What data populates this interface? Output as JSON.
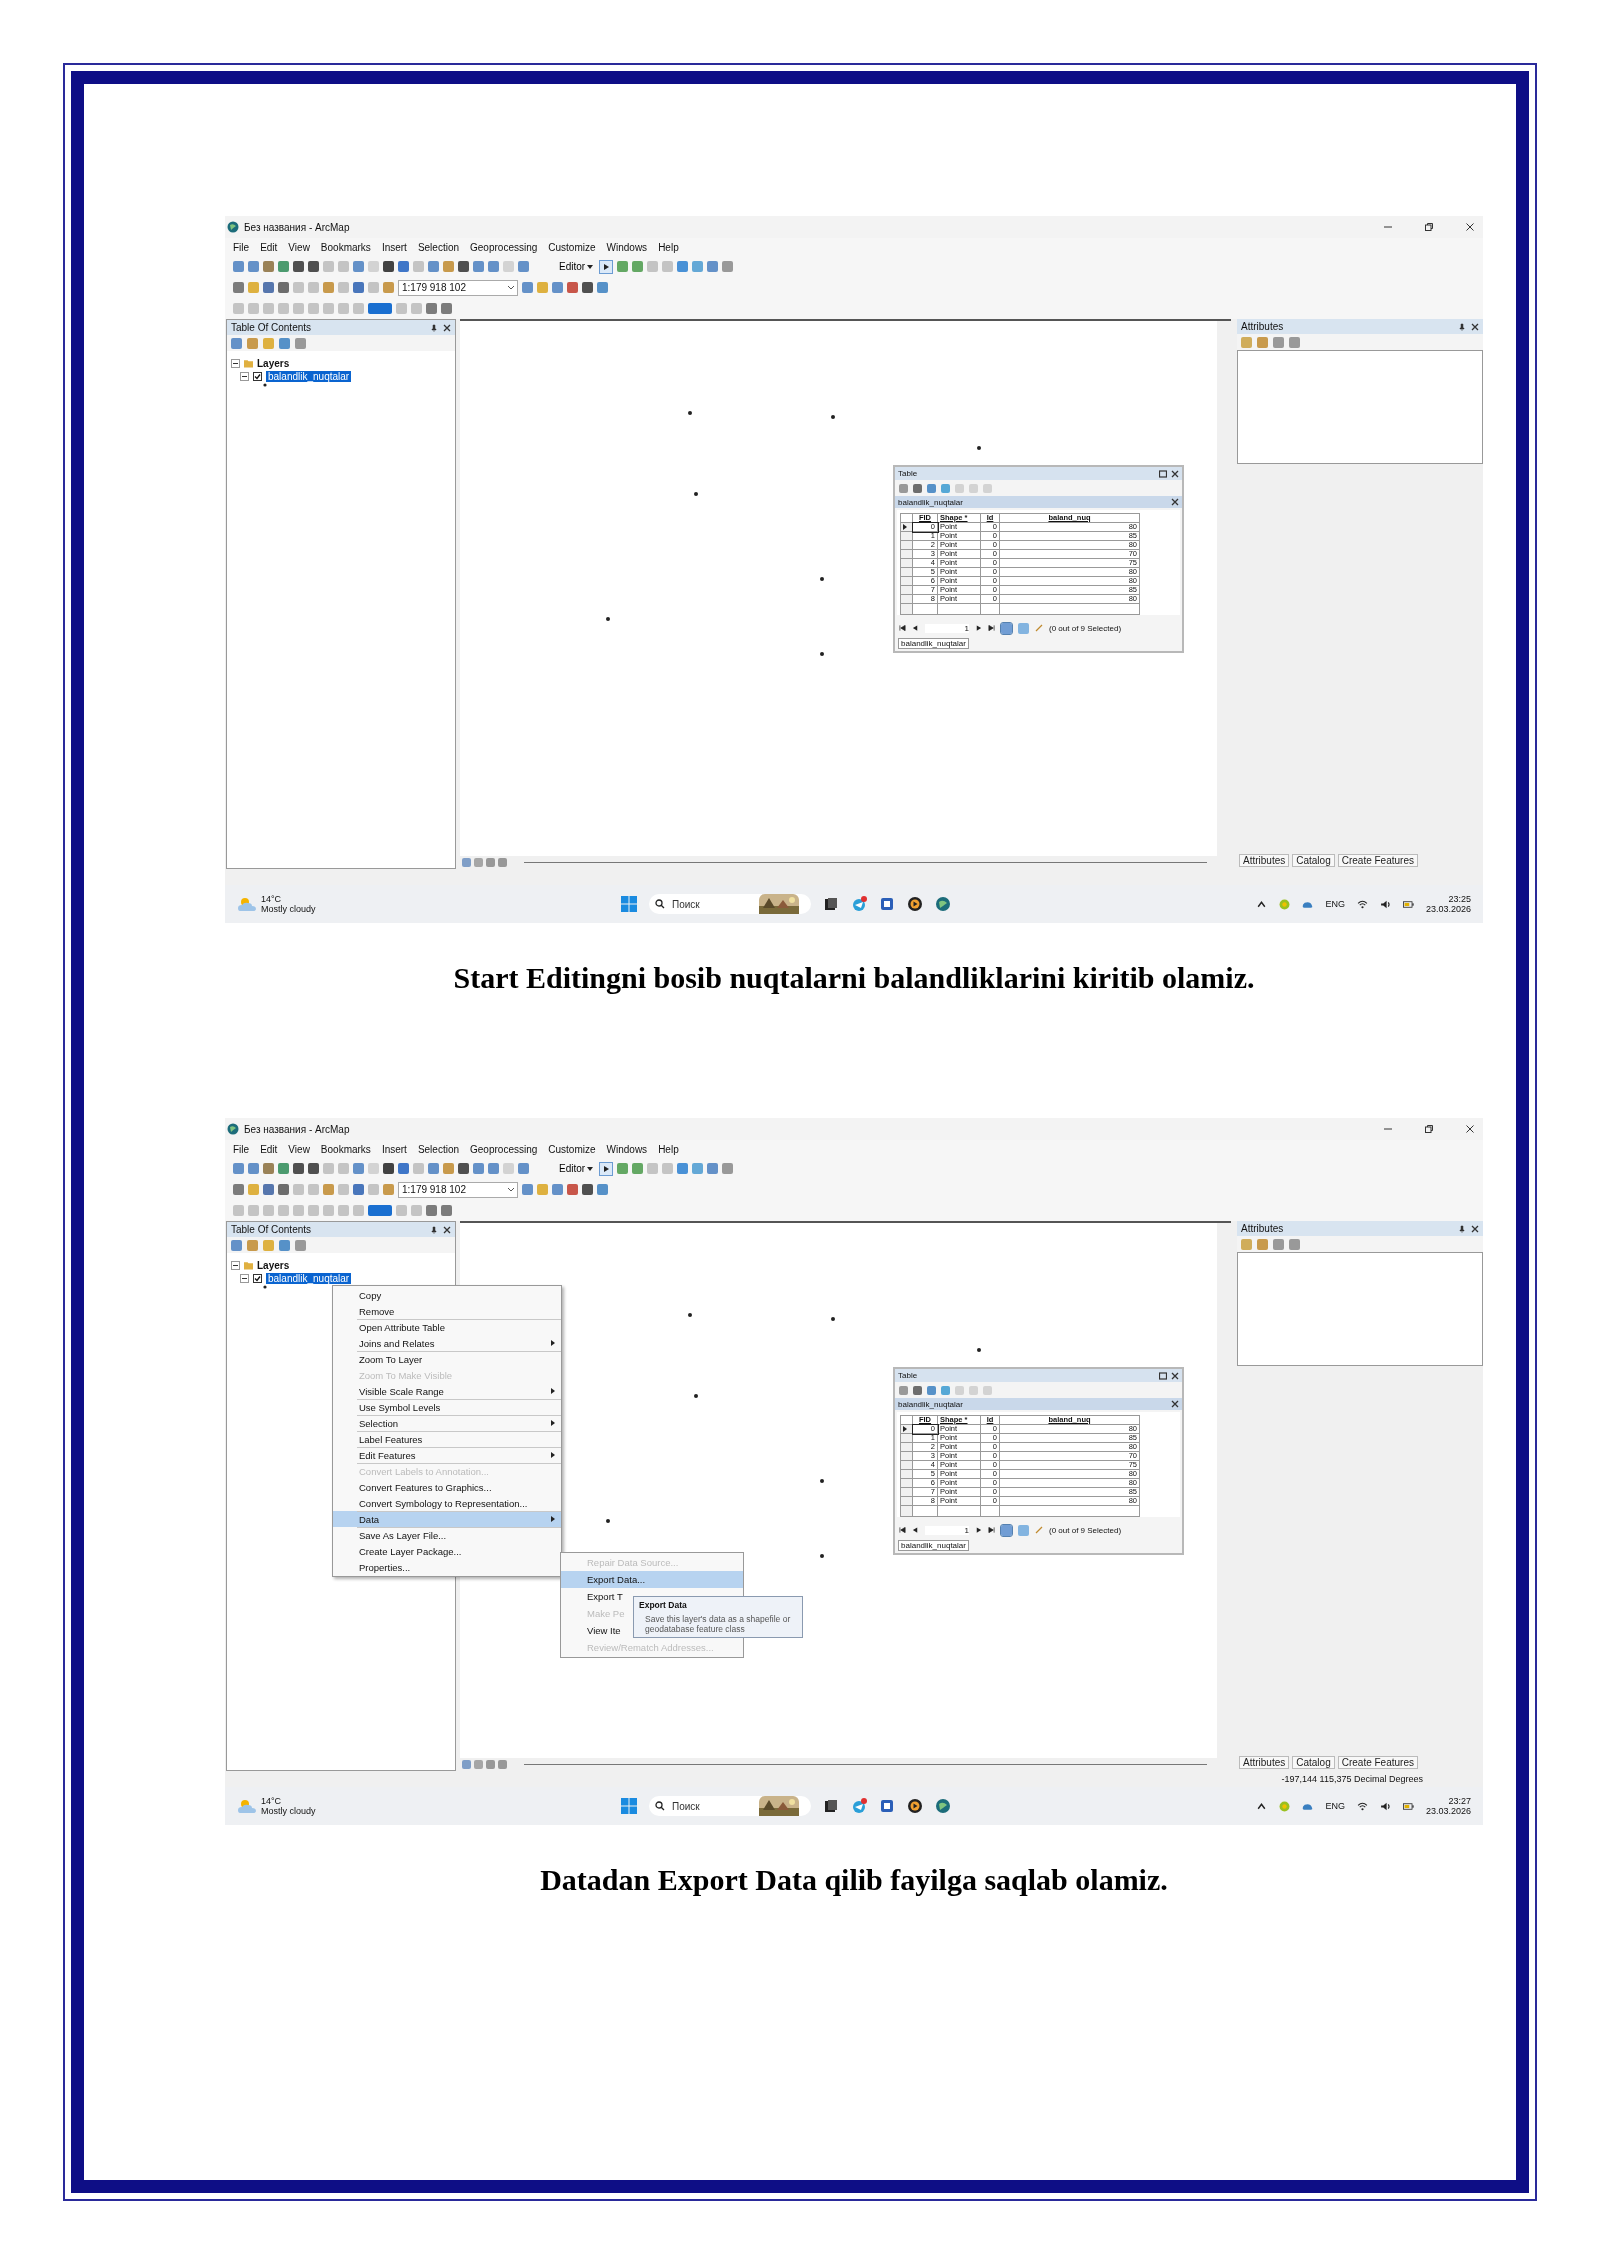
{
  "sections": [
    {
      "screenshot": {
        "window": {
          "title": "Без названия - ArcMap"
        },
        "menu": [
          "File",
          "Edit",
          "View",
          "Bookmarks",
          "Insert",
          "Selection",
          "Geoprocessing",
          "Customize",
          "Windows",
          "Help"
        ],
        "editor_label": "Editor",
        "scale": "1:179 918 102",
        "toc": {
          "title": "Table Of Contents",
          "root": "Layers",
          "layer": {
            "name": "balandlik_nuqtalar",
            "checked": true,
            "selected": true
          }
        },
        "attributes": {
          "title": "Attributes"
        },
        "table": {
          "title": "Table",
          "layer_title": "balandlik_nuqtalar",
          "columns": [
            "FID",
            "Shape *",
            "Id",
            "baland_nuq"
          ],
          "rows": [
            {
              "cells": [
                "0",
                "Point",
                "0",
                "80"
              ],
              "current": true
            },
            {
              "cells": [
                "1",
                "Point",
                "0",
                "85"
              ],
              "current": false
            },
            {
              "cells": [
                "2",
                "Point",
                "0",
                "80"
              ],
              "current": false
            },
            {
              "cells": [
                "3",
                "Point",
                "0",
                "70"
              ],
              "current": false
            },
            {
              "cells": [
                "4",
                "Point",
                "0",
                "75"
              ],
              "current": false
            },
            {
              "cells": [
                "5",
                "Point",
                "0",
                "80"
              ],
              "current": false
            },
            {
              "cells": [
                "6",
                "Point",
                "0",
                "80"
              ],
              "current": false
            },
            {
              "cells": [
                "7",
                "Point",
                "0",
                "85"
              ],
              "current": false
            },
            {
              "cells": [
                "8",
                "Point",
                "0",
                "80"
              ],
              "current": false
            }
          ],
          "page": "1",
          "selection": "(0 out of 9 Selected)",
          "tab": "balandlik_nuqtalar"
        },
        "dock_tabs": [
          "Attributes",
          "Catalog",
          "Create Features"
        ],
        "taskbar": {
          "temperature": "14°C",
          "weather": "Mostly cloudy",
          "search_placeholder": "Поиск",
          "language": "ENG",
          "time": "23:25",
          "date": "23.03.2026"
        }
      },
      "caption": "Start Editingni bosib nuqtalarni balandliklarini kiritib olamiz."
    },
    {
      "screenshot": {
        "window": {
          "title": "Без названия - ArcMap"
        },
        "menu": [
          "File",
          "Edit",
          "View",
          "Bookmarks",
          "Insert",
          "Selection",
          "Geoprocessing",
          "Customize",
          "Windows",
          "Help"
        ],
        "editor_label": "Editor",
        "scale": "1:179 918 102",
        "toc": {
          "title": "Table Of Contents",
          "root": "Layers",
          "layer": {
            "name": "balandlik_nuqtalar",
            "checked": true,
            "selected": true
          }
        },
        "attributes": {
          "title": "Attributes"
        },
        "table": {
          "title": "Table",
          "layer_title": "balandlik_nuqtalar",
          "columns": [
            "FID",
            "Shape *",
            "Id",
            "baland_nuq"
          ],
          "rows": [
            {
              "cells": [
                "0",
                "Point",
                "0",
                "80"
              ],
              "current": true
            },
            {
              "cells": [
                "1",
                "Point",
                "0",
                "85"
              ],
              "current": false
            },
            {
              "cells": [
                "2",
                "Point",
                "0",
                "80"
              ],
              "current": false
            },
            {
              "cells": [
                "3",
                "Point",
                "0",
                "70"
              ],
              "current": false
            },
            {
              "cells": [
                "4",
                "Point",
                "0",
                "75"
              ],
              "current": false
            },
            {
              "cells": [
                "5",
                "Point",
                "0",
                "80"
              ],
              "current": false
            },
            {
              "cells": [
                "6",
                "Point",
                "0",
                "80"
              ],
              "current": false
            },
            {
              "cells": [
                "7",
                "Point",
                "0",
                "85"
              ],
              "current": false
            },
            {
              "cells": [
                "8",
                "Point",
                "0",
                "80"
              ],
              "current": false
            }
          ],
          "page": "1",
          "selection": "(0 out of 9 Selected)",
          "tab": "balandlik_nuqtalar"
        },
        "dock_tabs": [
          "Attributes",
          "Catalog",
          "Create Features"
        ],
        "status": "-197,144  115,375 Decimal Degrees",
        "context_menu": [
          {
            "label": "Copy",
            "disabled": false,
            "selected": false,
            "submenu": false,
            "separator_before": false
          },
          {
            "label": "Remove",
            "disabled": false,
            "selected": false,
            "submenu": false,
            "separator_before": false
          },
          {
            "label": "Open Attribute Table",
            "disabled": false,
            "selected": false,
            "submenu": false,
            "separator_before": true
          },
          {
            "label": "Joins and Relates",
            "disabled": false,
            "selected": false,
            "submenu": true,
            "separator_before": false
          },
          {
            "label": "Zoom To Layer",
            "disabled": false,
            "selected": false,
            "submenu": false,
            "separator_before": true
          },
          {
            "label": "Zoom To Make Visible",
            "disabled": true,
            "selected": false,
            "submenu": false,
            "separator_before": false
          },
          {
            "label": "Visible Scale Range",
            "disabled": false,
            "selected": false,
            "submenu": true,
            "separator_before": false
          },
          {
            "label": "Use Symbol Levels",
            "disabled": false,
            "selected": false,
            "submenu": false,
            "separator_before": true
          },
          {
            "label": "Selection",
            "disabled": false,
            "selected": false,
            "submenu": true,
            "separator_before": true
          },
          {
            "label": "Label Features",
            "disabled": false,
            "selected": false,
            "submenu": false,
            "separator_before": true
          },
          {
            "label": "Edit Features",
            "disabled": false,
            "selected": false,
            "submenu": true,
            "separator_before": true
          },
          {
            "label": "Convert Labels to Annotation...",
            "disabled": true,
            "selected": false,
            "submenu": false,
            "separator_before": true
          },
          {
            "label": "Convert Features to Graphics...",
            "disabled": false,
            "selected": false,
            "submenu": false,
            "separator_before": false
          },
          {
            "label": "Convert Symbology to Representation...",
            "disabled": false,
            "selected": false,
            "submenu": false,
            "separator_before": false
          },
          {
            "label": "Data",
            "disabled": false,
            "selected": true,
            "submenu": true,
            "separator_before": true
          },
          {
            "label": "Save As Layer File...",
            "disabled": false,
            "selected": false,
            "submenu": false,
            "separator_before": true
          },
          {
            "label": "Create Layer Package...",
            "disabled": false,
            "selected": false,
            "submenu": false,
            "separator_before": false
          },
          {
            "label": "Properties...",
            "disabled": false,
            "selected": false,
            "submenu": false,
            "separator_before": false
          }
        ],
        "submenu": [
          {
            "label": "Repair Data Source...",
            "disabled": true,
            "selected": false
          },
          {
            "label": "Export Data...",
            "disabled": false,
            "selected": true
          },
          {
            "label": "Export T",
            "disabled": false,
            "selected": false
          },
          {
            "label": "Make Pe",
            "disabled": true,
            "selected": false
          },
          {
            "label": "View Ite",
            "disabled": false,
            "selected": false
          },
          {
            "label": "Review/Rematch Addresses...",
            "disabled": true,
            "selected": false
          }
        ],
        "tooltip": {
          "title": "Export Data",
          "text": "Save this layer's data as a shapefile or geodatabase feature class"
        },
        "taskbar": {
          "temperature": "14°C",
          "weather": "Mostly cloudy",
          "search_placeholder": "Поиск",
          "language": "ENG",
          "time": "23:27",
          "date": "23.03.2026"
        }
      },
      "caption": "Datadan Export Data qilib fayilga saqlab olamiz."
    }
  ]
}
